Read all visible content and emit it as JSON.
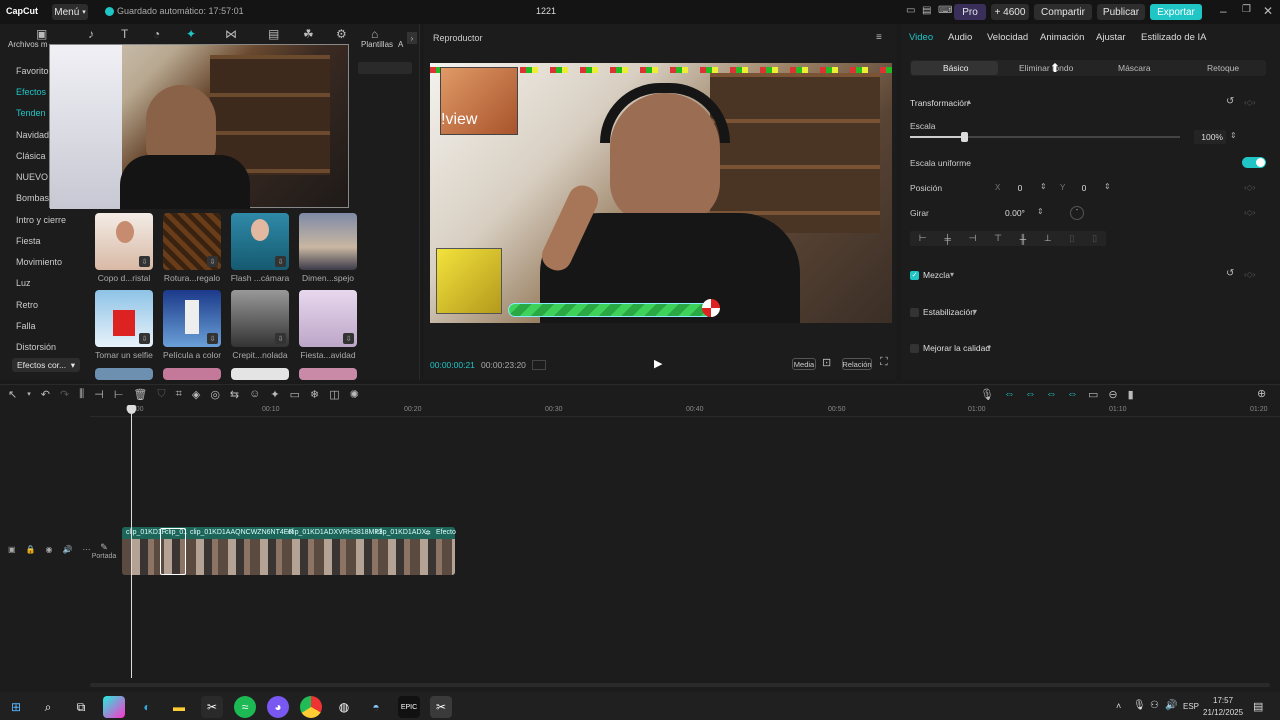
{
  "titlebar": {
    "brand": "CapCut",
    "menu": "Menú",
    "autosave": "Guardado automático: 17:57:01",
    "project": "1221",
    "pro": "Pro",
    "credits": "+ 4600",
    "share": "Compartir",
    "publish": "Publicar",
    "export": "Exportar"
  },
  "media": {
    "tab_archivos": "Archivos m",
    "tab_plantillas": "Plantillas",
    "tab_a": "A",
    "categories": [
      "Favorito",
      "Efectos",
      "Tenden",
      "Navidad",
      "Clásica",
      "NUEVO",
      "Bombas",
      "Intro y cierre",
      "Fiesta",
      "Movimiento",
      "Luz",
      "Retro",
      "Falla",
      "Distorsión"
    ],
    "category_dropdown": "Efectos cor...",
    "thumbs": [
      "Copo d...ristal",
      "Rotura...regalo",
      "Flash ...cámara",
      "Dimen...spejo",
      "Tomar un selfie",
      "Película a color",
      "Crepit...nolada",
      "Fiesta...avidad"
    ]
  },
  "player": {
    "title": "Reproductor",
    "overlay_text": "!view",
    "current_time": "00:00:00:21",
    "total_time": "00:00:23:20",
    "media_btn": "Media",
    "ratio_btn": "Relación"
  },
  "props": {
    "tabs": [
      "Video",
      "Audio",
      "Velocidad",
      "Animación",
      "Ajustar",
      "Estilizado de IA"
    ],
    "subtabs": [
      "Básico",
      "Eliminar fondo",
      "Máscara",
      "Retoque"
    ],
    "transform": "Transformación",
    "scale_label": "Escala",
    "scale_value": "100%",
    "uniform": "Escala uniforme",
    "position": "Posición",
    "x_label": "X",
    "x_val": "0",
    "y_label": "Y",
    "y_val": "0",
    "rotate": "Girar",
    "rotate_val": "0.00°",
    "blend": "Mezcla",
    "stabilize": "Estabilización",
    "enhance": "Mejorar la calidad"
  },
  "timeline": {
    "ticks": [
      "00:00",
      "00:10",
      "00:20",
      "00:30",
      "00:40",
      "00:50",
      "01:00",
      "01:10",
      "01:20"
    ],
    "cover": "Portada",
    "clips": [
      "clip_01KD1F",
      "clip_01",
      "clip_01KD1AAQNCWZN6NT4ER",
      "clip_01KD1ADXVRH3818MF3",
      "clip_01KD1ADX",
      "Efecto"
    ]
  },
  "taskbar": {
    "lang": "ESP",
    "time": "17:57",
    "date": "21/12/2025"
  },
  "colors": {
    "accent": "#20c5c6",
    "bg": "#1c1c1c"
  }
}
